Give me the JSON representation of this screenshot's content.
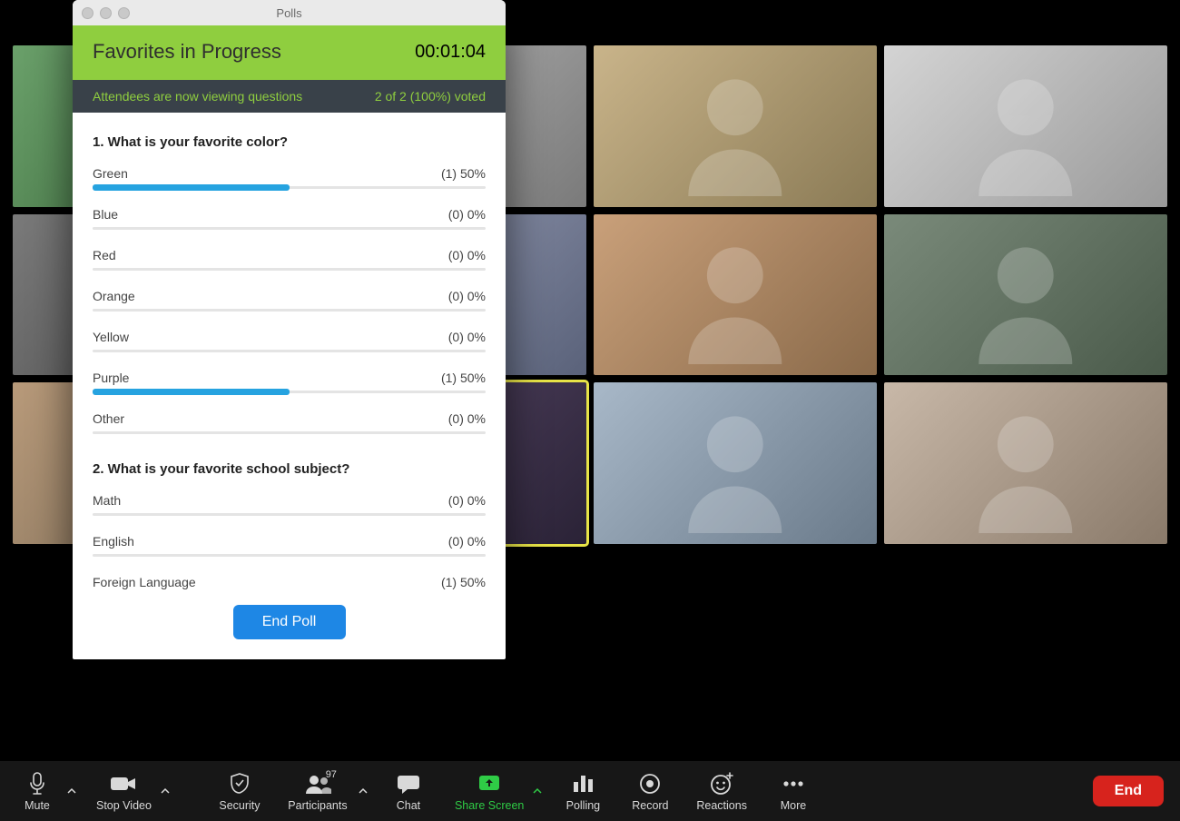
{
  "polls": {
    "window_title": "Polls",
    "header_title": "Favorites in Progress",
    "timer": "00:01:04",
    "status_left": "Attendees are now viewing questions",
    "status_right": "2 of 2 (100%) voted",
    "end_poll_label": "End Poll",
    "questions": [
      {
        "title": "1. What is your favorite color?",
        "options": [
          {
            "label": "Green",
            "count": "(1) 50%",
            "pct": 50
          },
          {
            "label": "Blue",
            "count": "(0) 0%",
            "pct": 0
          },
          {
            "label": "Red",
            "count": "(0) 0%",
            "pct": 0
          },
          {
            "label": "Orange",
            "count": "(0) 0%",
            "pct": 0
          },
          {
            "label": "Yellow",
            "count": "(0) 0%",
            "pct": 0
          },
          {
            "label": "Purple",
            "count": "(1) 50%",
            "pct": 50
          },
          {
            "label": "Other",
            "count": "(0) 0%",
            "pct": 0
          }
        ]
      },
      {
        "title": "2. What is your favorite school subject?",
        "options": [
          {
            "label": "Math",
            "count": "(0) 0%",
            "pct": 0
          },
          {
            "label": "English",
            "count": "(0) 0%",
            "pct": 0
          },
          {
            "label": "Foreign Language",
            "count": "(1) 50%",
            "pct": 50
          }
        ]
      }
    ]
  },
  "toolbar": {
    "mute": "Mute",
    "stop_video": "Stop Video",
    "security": "Security",
    "participants": "Participants",
    "participants_count": "97",
    "chat": "Chat",
    "share_screen": "Share Screen",
    "polling": "Polling",
    "record": "Record",
    "reactions": "Reactions",
    "more": "More",
    "end": "End"
  },
  "grid": {
    "tiles": 12,
    "active_index": 9
  }
}
